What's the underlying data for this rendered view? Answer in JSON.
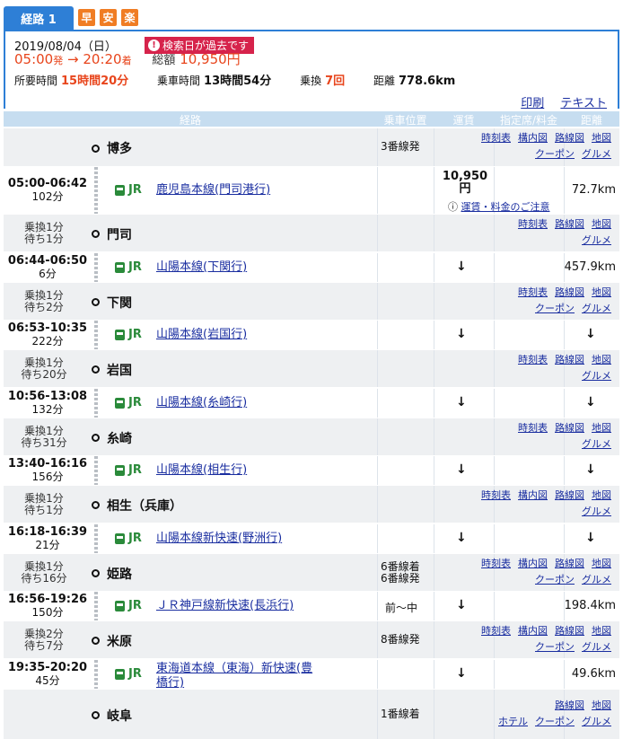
{
  "tabs": {
    "route_label": "経路 1",
    "badges": [
      "早",
      "安",
      "楽"
    ]
  },
  "summary": {
    "date": "2019/08/04（日）",
    "past_notice": "検索日が過去です",
    "depart": "05:00",
    "depart_suffix": "発",
    "arrow": "→",
    "arrive": "20:20",
    "arrive_suffix": "着",
    "fare_label": "総額",
    "fare_value": "10,950円",
    "duration_label": "所要時間",
    "duration_value": "15時間20分",
    "ride_label": "乗車時間",
    "ride_value": "13時間54分",
    "transfer_label": "乗換",
    "transfer_value": "7回",
    "distance_label": "距離",
    "distance_value": "778.6km",
    "print_label": "印刷",
    "text_label": "テキスト"
  },
  "columns": {
    "route": "経路",
    "position": "乗車位置",
    "fare": "運賃",
    "reserved": "指定席/料金",
    "distance": "距離"
  },
  "stations": [
    {
      "name": "博多",
      "xfer1": "",
      "xfer2": "",
      "platform": "3番線発",
      "links1": [
        "時刻表",
        "構内図",
        "路線図",
        "地図"
      ],
      "links2": [
        "クーポン",
        "グルメ"
      ]
    },
    {
      "name": "門司",
      "xfer1": "乗換1分",
      "xfer2": "待ち1分",
      "platform": "",
      "links1": [
        "時刻表",
        "路線図",
        "地図"
      ],
      "links2": [
        "グルメ"
      ]
    },
    {
      "name": "下関",
      "xfer1": "乗換1分",
      "xfer2": "待ち2分",
      "platform": "",
      "links1": [
        "時刻表",
        "路線図",
        "地図"
      ],
      "links2": [
        "クーポン",
        "グルメ"
      ]
    },
    {
      "name": "岩国",
      "xfer1": "乗換1分",
      "xfer2": "待ち20分",
      "platform": "",
      "links1": [
        "時刻表",
        "路線図",
        "地図"
      ],
      "links2": [
        "グルメ"
      ]
    },
    {
      "name": "糸崎",
      "xfer1": "乗換1分",
      "xfer2": "待ち31分",
      "platform": "",
      "links1": [
        "時刻表",
        "路線図",
        "地図"
      ],
      "links2": [
        "グルメ"
      ]
    },
    {
      "name": "相生（兵庫）",
      "xfer1": "乗換1分",
      "xfer2": "待ち1分",
      "platform": "",
      "links1": [
        "時刻表",
        "構内図",
        "路線図",
        "地図"
      ],
      "links2": [
        "グルメ"
      ]
    },
    {
      "name": "姫路",
      "xfer1": "乗換1分",
      "xfer2": "待ち16分",
      "platform": "6番線着\n6番線発",
      "links1": [
        "時刻表",
        "構内図",
        "路線図",
        "地図"
      ],
      "links2": [
        "クーポン",
        "グルメ"
      ]
    },
    {
      "name": "米原",
      "xfer1": "乗換2分",
      "xfer2": "待ち7分",
      "platform": "8番線発",
      "links1": [
        "時刻表",
        "構内図",
        "路線図",
        "地図"
      ],
      "links2": [
        "クーポン",
        "グルメ"
      ]
    },
    {
      "name": "岐阜",
      "xfer1": "",
      "xfer2": "",
      "platform": "1番線着",
      "links1": [
        "路線図",
        "地図"
      ],
      "links2": [
        "ホテル",
        "クーポン",
        "グルメ"
      ]
    }
  ],
  "segments": [
    {
      "time": "05:00-06:42",
      "minutes": "102分",
      "company": "JR",
      "line": "鹿児島本線(門司港行)",
      "position": "",
      "fare": "10,950",
      "fare_unit": "円",
      "fare_note": "運賃・料金のご注意",
      "fare_arrow": "",
      "distance": "72.7km"
    },
    {
      "time": "06:44-06:50",
      "minutes": "6分",
      "company": "JR",
      "line": "山陽本線(下関行)",
      "position": "",
      "fare": "",
      "fare_unit": "",
      "fare_note": "",
      "fare_arrow": "↓",
      "distance": "457.9km"
    },
    {
      "time": "06:53-10:35",
      "minutes": "222分",
      "company": "JR",
      "line": "山陽本線(岩国行)",
      "position": "",
      "fare": "",
      "fare_unit": "",
      "fare_note": "",
      "fare_arrow": "↓",
      "distance": "↓"
    },
    {
      "time": "10:56-13:08",
      "minutes": "132分",
      "company": "JR",
      "line": "山陽本線(糸崎行)",
      "position": "",
      "fare": "",
      "fare_unit": "",
      "fare_note": "",
      "fare_arrow": "↓",
      "distance": "↓"
    },
    {
      "time": "13:40-16:16",
      "minutes": "156分",
      "company": "JR",
      "line": "山陽本線(相生行)",
      "position": "",
      "fare": "",
      "fare_unit": "",
      "fare_note": "",
      "fare_arrow": "↓",
      "distance": "↓"
    },
    {
      "time": "16:18-16:39",
      "minutes": "21分",
      "company": "JR",
      "line": "山陽本線新快速(野洲行)",
      "position": "",
      "fare": "",
      "fare_unit": "",
      "fare_note": "",
      "fare_arrow": "↓",
      "distance": "↓"
    },
    {
      "time": "16:56-19:26",
      "minutes": "150分",
      "company": "JR",
      "line": "ＪＲ神戸線新快速(長浜行)",
      "position": "前～中",
      "fare": "",
      "fare_unit": "",
      "fare_note": "",
      "fare_arrow": "↓",
      "distance": "198.4km"
    },
    {
      "time": "19:35-20:20",
      "minutes": "45分",
      "company": "JR",
      "line": "東海道本線（東海）新快速(豊\n橋行)",
      "position": "",
      "fare": "",
      "fare_unit": "",
      "fare_note": "",
      "fare_arrow": "↓",
      "distance": "49.6km"
    }
  ]
}
